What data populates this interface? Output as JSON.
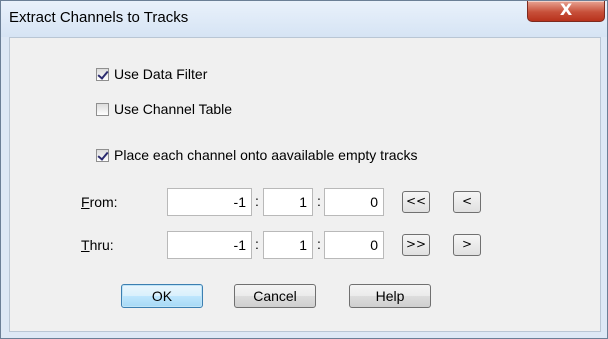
{
  "window": {
    "title": "Extract Channels to Tracks",
    "close_label": "X"
  },
  "options": {
    "use_data_filter": {
      "label": "Use Data Filter",
      "checked": true
    },
    "use_channel_table": {
      "label": "Use Channel Table",
      "checked": false
    },
    "place_each_channel": {
      "label": "Place each channel onto aavailable empty tracks",
      "checked": true
    }
  },
  "from": {
    "label_hotkey": "F",
    "label_rest": "rom:",
    "bar": "-1",
    "beat": "1",
    "tick": "0",
    "btn_first": "<<",
    "btn_prev": "<"
  },
  "thru": {
    "label_hotkey": "T",
    "label_rest": "hru:",
    "bar": "-1",
    "beat": "1",
    "tick": "0",
    "btn_last": ">>",
    "btn_next": ">"
  },
  "separator": ":",
  "buttons": {
    "ok": "OK",
    "cancel": "Cancel",
    "help": "Help"
  }
}
